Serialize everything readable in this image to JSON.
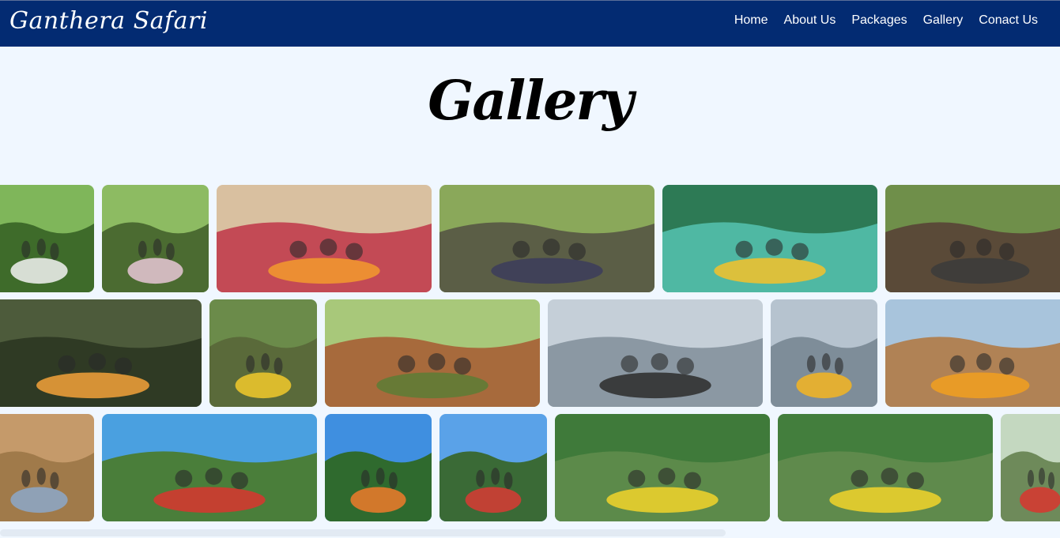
{
  "site": {
    "logo": "Ganthera Safari",
    "nav": [
      "Home",
      "About Us",
      "Packages",
      "Gallery",
      "Conact Us"
    ]
  },
  "page": {
    "title": "Gallery"
  },
  "gallery": {
    "rows": [
      [
        {
          "name": "photo-family-sign",
          "sky": "#7fb65a",
          "ground": "#3e6b2a",
          "accent": "#f2f2f2"
        },
        {
          "name": "photo-family-couple",
          "sky": "#8dbb62",
          "ground": "#4b6b31",
          "accent": "#e8c7d6"
        },
        {
          "name": "photo-family-hats",
          "sky": "#d9c0a0",
          "ground": "#c34a55",
          "accent": "#f39a2e"
        },
        {
          "name": "photo-group-outdoor",
          "sky": "#8aa85a",
          "ground": "#5b5e46",
          "accent": "#3c3c5c"
        },
        {
          "name": "photo-boat-lagoon",
          "sky": "#2d7a55",
          "ground": "#4fb8a3",
          "accent": "#f4c12a"
        },
        {
          "name": "photo-group-hut",
          "sky": "#6f8f4a",
          "ground": "#5a4a38",
          "accent": "#3b3b3b"
        }
      ],
      [
        {
          "name": "photo-mangrove-tunnel",
          "sky": "#4d5b3b",
          "ground": "#2f3a24",
          "accent": "#f3a23a"
        },
        {
          "name": "photo-mangrove-boat",
          "sky": "#6b8b4a",
          "ground": "#5a6a3a",
          "accent": "#f2c92c"
        },
        {
          "name": "photo-wooden-bridge",
          "sky": "#a8c87a",
          "ground": "#a76a3c",
          "accent": "#5c7d35"
        },
        {
          "name": "photo-lake-sky",
          "sky": "#c5cfd8",
          "ground": "#8b98a3",
          "accent": "#2c2c2c"
        },
        {
          "name": "photo-lake-boat",
          "sky": "#b6c3cf",
          "ground": "#7e8d99",
          "accent": "#f5b521"
        },
        {
          "name": "photo-fruit-stall",
          "sky": "#a8c4dc",
          "ground": "#b08255",
          "accent": "#f2a020"
        }
      ],
      [
        {
          "name": "photo-hut-interior",
          "sky": "#c59a6a",
          "ground": "#a07a4a",
          "accent": "#8ca8c9"
        },
        {
          "name": "photo-boat-group-lifejackets",
          "sky": "#4aa0e0",
          "ground": "#4a7e3a",
          "accent": "#d9352f"
        },
        {
          "name": "photo-boat-blue-sky",
          "sky": "#3f8fe0",
          "ground": "#2f6a2e",
          "accent": "#ef7a2a"
        },
        {
          "name": "photo-boat-river",
          "sky": "#5aa2e8",
          "ground": "#3a6a36",
          "accent": "#d93a34"
        },
        {
          "name": "photo-boat-hats-1",
          "sky": "#3f7a3a",
          "ground": "#5c8a4a",
          "accent": "#f2d32a"
        },
        {
          "name": "photo-boat-hats-2",
          "sky": "#437e3d",
          "ground": "#5f8a4c",
          "accent": "#f2d32a"
        },
        {
          "name": "photo-boat-front",
          "sky": "#c4d8c0",
          "ground": "#6e8a5a",
          "accent": "#d9352f"
        }
      ]
    ]
  }
}
